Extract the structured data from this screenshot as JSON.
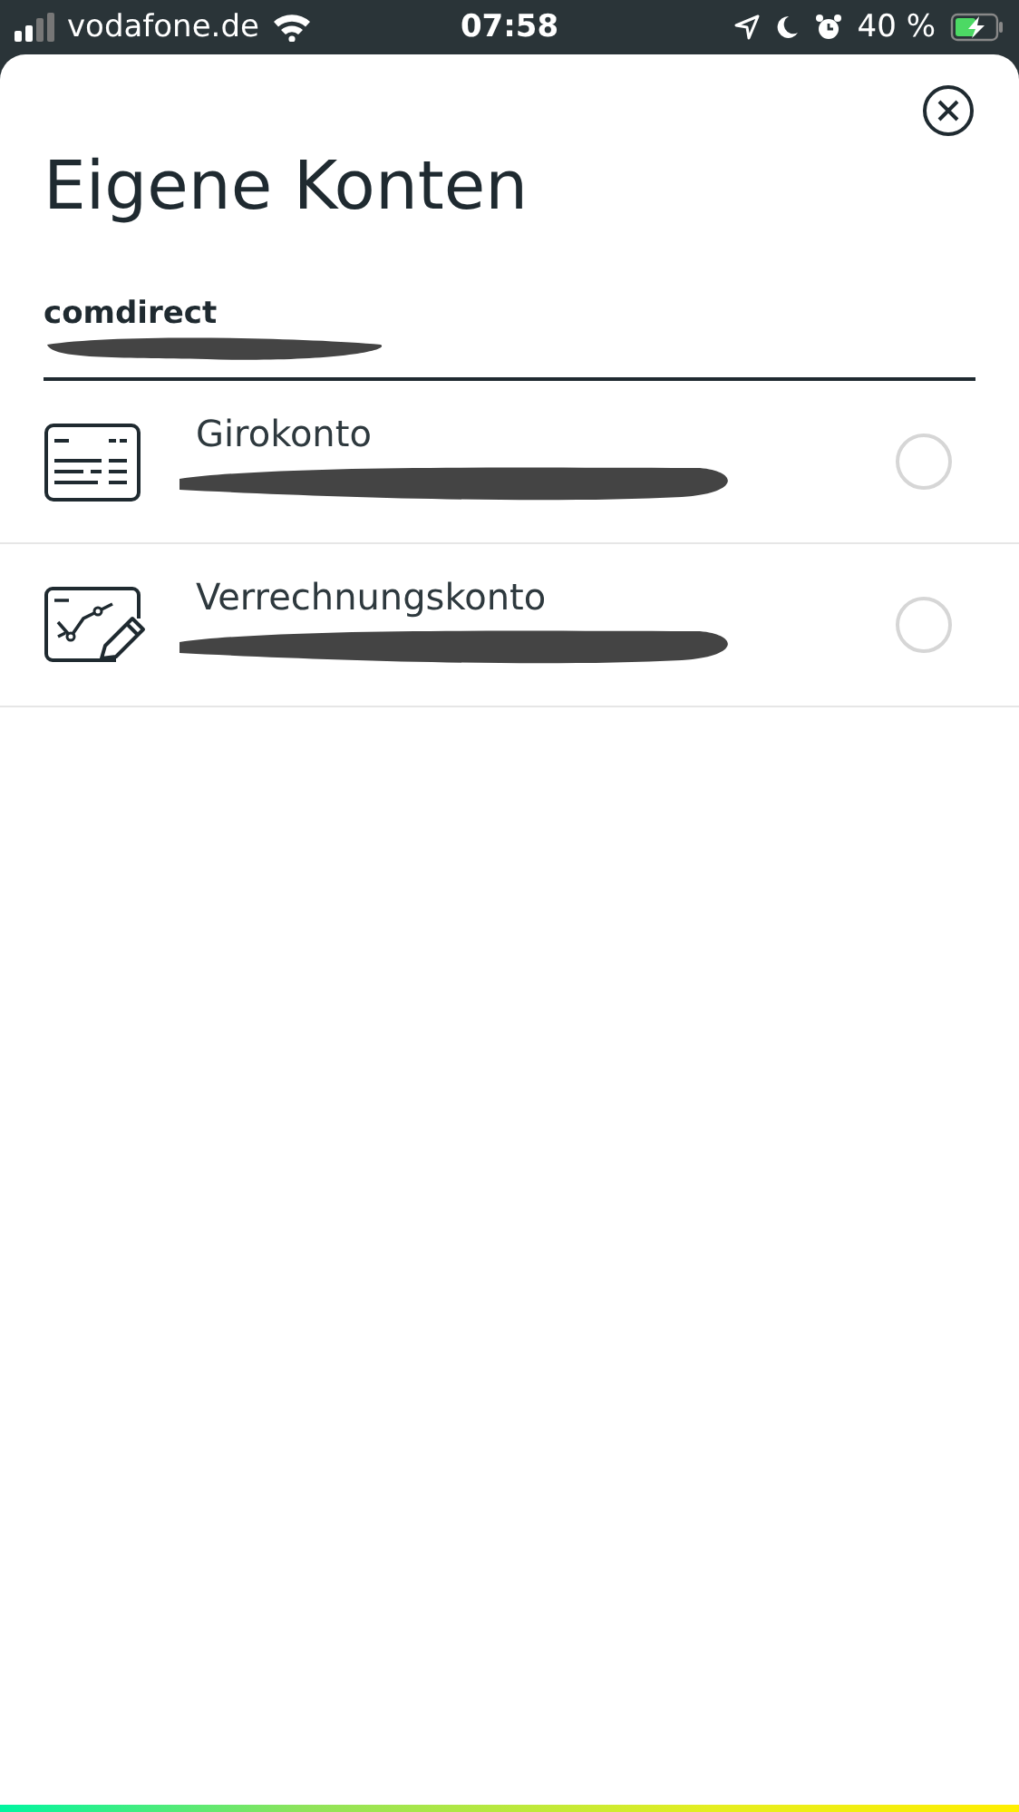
{
  "status_bar": {
    "carrier": "vodafone.de",
    "time": "07:58",
    "battery": "40 %"
  },
  "sheet": {
    "title": "Eigene Konten",
    "bank": "comdirect",
    "accounts": [
      {
        "name": "Girokonto",
        "kind": "card",
        "selected": false
      },
      {
        "name": "Verrechnungskonto",
        "kind": "chart",
        "selected": false
      }
    ]
  }
}
